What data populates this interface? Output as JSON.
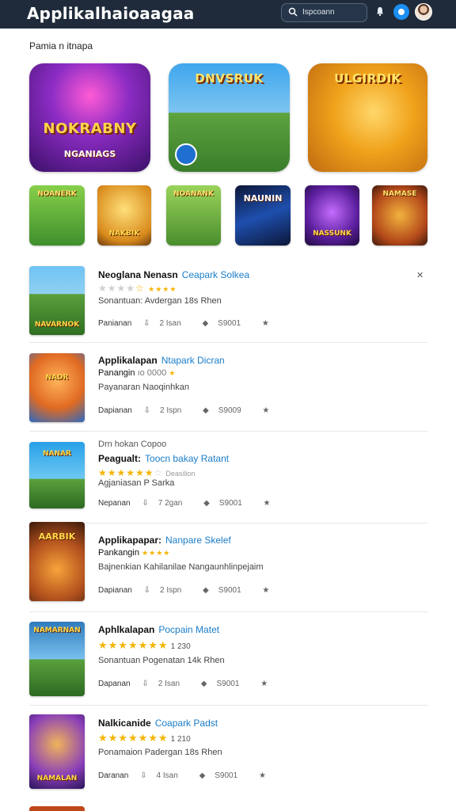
{
  "header": {
    "title": "Applikalhaioaagaa",
    "search_placeholder": "Ispcoann"
  },
  "section": {
    "title": "Pamia n itnapa"
  },
  "heroes": [
    {
      "title": "NOKRABNY",
      "subtitle": "NGANIAGS",
      "bg": "#5a2b7a"
    },
    {
      "title": "DNVSRUK",
      "subtitle": "",
      "bg": "#3f8f4a"
    },
    {
      "title": "ULGIRDIK",
      "subtitle": "",
      "bg": "#f0a21b"
    }
  ],
  "tiles": [
    {
      "title": "NOANERK",
      "bg": "#4d9a36"
    },
    {
      "title": "NAKBIK",
      "bg": "#e7a326"
    },
    {
      "title": "NOANANK",
      "bg": "#5ba035"
    },
    {
      "title": "NAUNIN",
      "bg": "#13204a"
    },
    {
      "title": "NASSUNK",
      "bg": "#3c1a6a"
    },
    {
      "title": "NAMASE",
      "bg": "#a33b16"
    }
  ],
  "apps": [
    {
      "name": "Neoglana Nenasn",
      "link": "Ceapark Solkea",
      "line2": "★★★★★★★★★",
      "line2_kind": "stars",
      "stars_on": 3,
      "line3": "Sonantuan: Avdergan 18s Rhen",
      "meta": [
        "Panianan",
        "2 Isan",
        "S9001"
      ],
      "thumb_title": "NAVARNOK",
      "thumb_bg": "#3d8a3a"
    },
    {
      "name": "Applikalapan",
      "link": "Ntapark Dicran",
      "line2": "Panangin",
      "line2_kind": "text",
      "line3": "Payanaran Naoqinhkan",
      "meta": [
        "Dapianan",
        "2 Ispn",
        "S9009"
      ],
      "thumb_title": "NADR",
      "thumb_bg": "#e57b2d"
    },
    {
      "name": "Peagualt:",
      "link": "Toocn bakay Ratant",
      "pre": "Drn hokan  Copoo",
      "line2": "★★★★★★",
      "line2_kind": "stars",
      "stars_on": 6,
      "line3": "Agjaniasan P Sarka",
      "meta": [
        "Nepanan",
        "7 2gan",
        "S9001"
      ],
      "thumb_title": "NANAR",
      "thumb_bg": "#2aa0d8"
    },
    {
      "name": "Applikapapar:",
      "link": "Nanpare Skelef",
      "line2": "Pankangin",
      "line2_kind": "text",
      "line3": "Bajnenkian Kahilanilae Nangaunhlinpejaim",
      "meta": [
        "Dapianan",
        "2 Ispn",
        "S9001"
      ],
      "thumb_title": "AARBIK",
      "thumb_bg": "#4a2510"
    },
    {
      "name": "Aphlkalapan",
      "link": "Pocpain Matet",
      "line2": "★★★★★★★  1 230",
      "line2_kind": "stars",
      "stars_on": 7,
      "line3": "Sonantuan Pogenatan 14k Rhen",
      "meta": [
        "Dapanan",
        "2 Isan",
        "S9001"
      ],
      "thumb_title": "NAMARNAN",
      "thumb_bg": "#2f7bbd"
    },
    {
      "name": "Nalkicanide",
      "link": "Coapark Padst",
      "line2": "★★★★★★★★  1 210",
      "line2_kind": "stars",
      "stars_on": 8,
      "line3": "Ponamaion Padergan 18s Rhen",
      "meta": [
        "Daranan",
        "4 Isan",
        "S9001"
      ],
      "thumb_title": "NAMALAN",
      "thumb_bg": "#4a3ba0"
    }
  ],
  "icons": {
    "download": "download-icon",
    "share": "share-icon",
    "star": "star-icon",
    "pin": "pin-icon"
  }
}
